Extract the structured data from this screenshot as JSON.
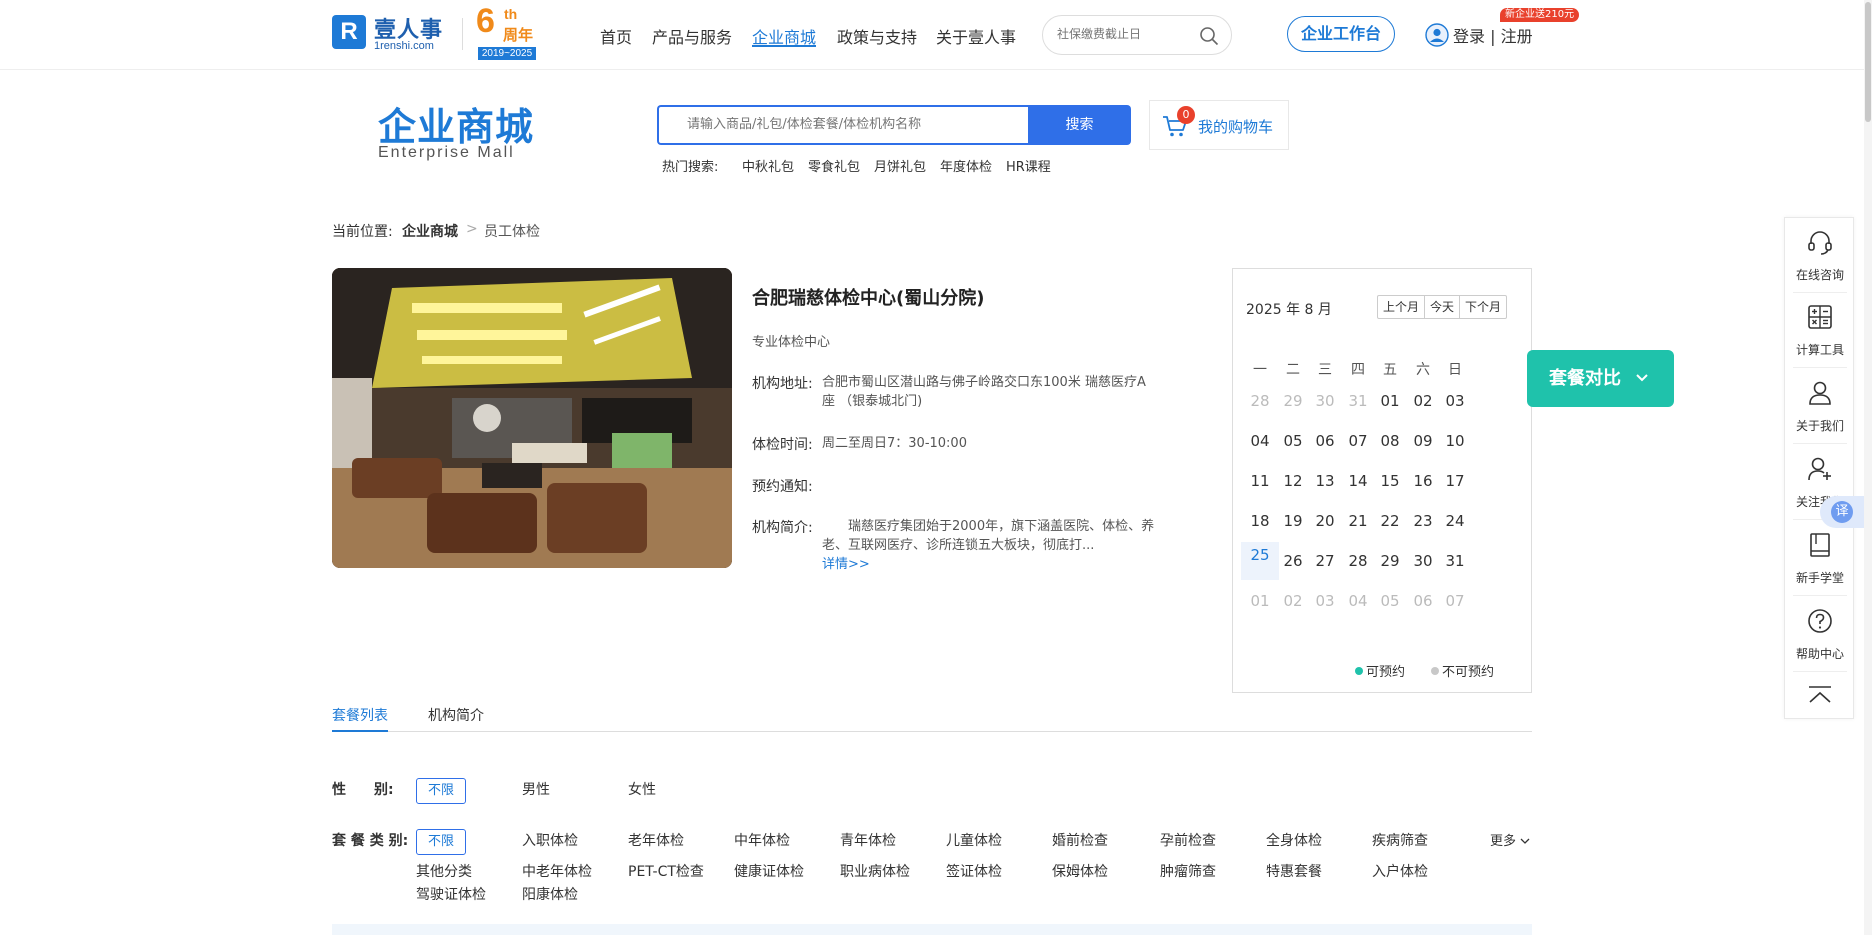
{
  "brand": {
    "logo_mark": "R",
    "name_cn": "壹人事",
    "name_en": "1renshi.com",
    "anniversary_num": "6",
    "anniversary_suffix": "th",
    "anniversary_label": "周年",
    "anniversary_years": "2019~2025"
  },
  "nav": {
    "items": [
      "首页",
      "产品与服务",
      "企业商城",
      "政策与支持",
      "关于壹人事"
    ],
    "active": "企业商城",
    "search_placeholder": "社保缴费截止日",
    "workbench": "企业工作台",
    "login": "登录 | 注册",
    "promo": "新企业送210元"
  },
  "mall": {
    "title": "企业商城",
    "subtitle": "Enterprise  Mall",
    "search_placeholder": "请输入商品/礼包/体检套餐/体检机构名称",
    "search_button": "搜索",
    "hot_label": "热门搜索:",
    "hot_items": [
      "中秋礼包",
      "零食礼包",
      "月饼礼包",
      "年度体检",
      "HR课程"
    ],
    "cart_count": "0",
    "cart_label": "我的购物车"
  },
  "breadcrumb": {
    "prefix": "当前位置:",
    "level1": "企业商城",
    "separator": ">",
    "level2": "员工体检"
  },
  "institution": {
    "name": "合肥瑞慈体检中心(蜀山分院)",
    "type": "专业体检中心",
    "address_label": "机构地址:",
    "address": "合肥市蜀山区潜山路与佛子岭路交口东100米 瑞慈医疗A座 （银泰城北门)",
    "hours_label": "体检时间:",
    "hours": "周二至周日7：30-10:00",
    "notice_label": "预约通知:",
    "notice": "",
    "intro_label": "机构简介:",
    "intro": "　　瑞慈医疗集团始于2000年，旗下涵盖医院、体检、养老、互联网医疗、诊所连锁五大板块，彻底打...",
    "more": "详情>>"
  },
  "calendar": {
    "title": "2025 年 8 月",
    "prev": "上个月",
    "today": "今天",
    "next": "下个月",
    "weekdays": [
      "一",
      "二",
      "三",
      "四",
      "五",
      "六",
      "日"
    ],
    "weeks": [
      [
        "28",
        "29",
        "30",
        "31",
        "01",
        "02",
        "03"
      ],
      [
        "04",
        "05",
        "06",
        "07",
        "08",
        "09",
        "10"
      ],
      [
        "11",
        "12",
        "13",
        "14",
        "15",
        "16",
        "17"
      ],
      [
        "18",
        "19",
        "20",
        "21",
        "22",
        "23",
        "24"
      ],
      [
        "25",
        "26",
        "27",
        "28",
        "29",
        "30",
        "31"
      ],
      [
        "01",
        "02",
        "03",
        "04",
        "05",
        "06",
        "07"
      ]
    ],
    "today_date": "25",
    "legend_available": "可预约",
    "legend_unavailable": "不可预约",
    "available_color": "#1fc2ab",
    "unavailable_color": "#c8c8c8"
  },
  "compare": {
    "label": "套餐对比"
  },
  "sidebar": {
    "items": [
      {
        "label": "在线咨询",
        "icon": "headset-icon"
      },
      {
        "label": "计算工具",
        "icon": "calculator-icon"
      },
      {
        "label": "关于我们",
        "icon": "person-icon"
      },
      {
        "label": "关注我们",
        "icon": "person-add-icon"
      },
      {
        "label": "新手学堂",
        "icon": "book-icon"
      },
      {
        "label": "帮助中心",
        "icon": "help-icon"
      }
    ],
    "translate": "译"
  },
  "tabs": [
    "套餐列表",
    "机构简介"
  ],
  "filters": {
    "gender_label": "性　　别:",
    "gender_selected": "不限",
    "gender_options": [
      "男性",
      "女性"
    ],
    "type_label": "套 餐 类 别:",
    "type_selected": "不限",
    "type_options_row1": [
      "入职体检",
      "老年体检",
      "中年体检",
      "青年体检",
      "儿童体检",
      "婚前检查",
      "孕前检查",
      "全身体检",
      "疾病筛查"
    ],
    "type_options_row2": [
      "其他分类",
      "中老年体检",
      "PET-CT检查",
      "健康证体检",
      "职业病体检",
      "签证体检",
      "保姆体检",
      "肿瘤筛查",
      "特惠套餐",
      "入户体检"
    ],
    "type_options_row3": [
      "驾驶证体检",
      "阳康体检"
    ],
    "more": "更多"
  },
  "colors": {
    "primary": "#1e7ad6",
    "accent": "#1fc2ab",
    "badge": "#e9412c",
    "anniversary": "#f08a1a"
  }
}
